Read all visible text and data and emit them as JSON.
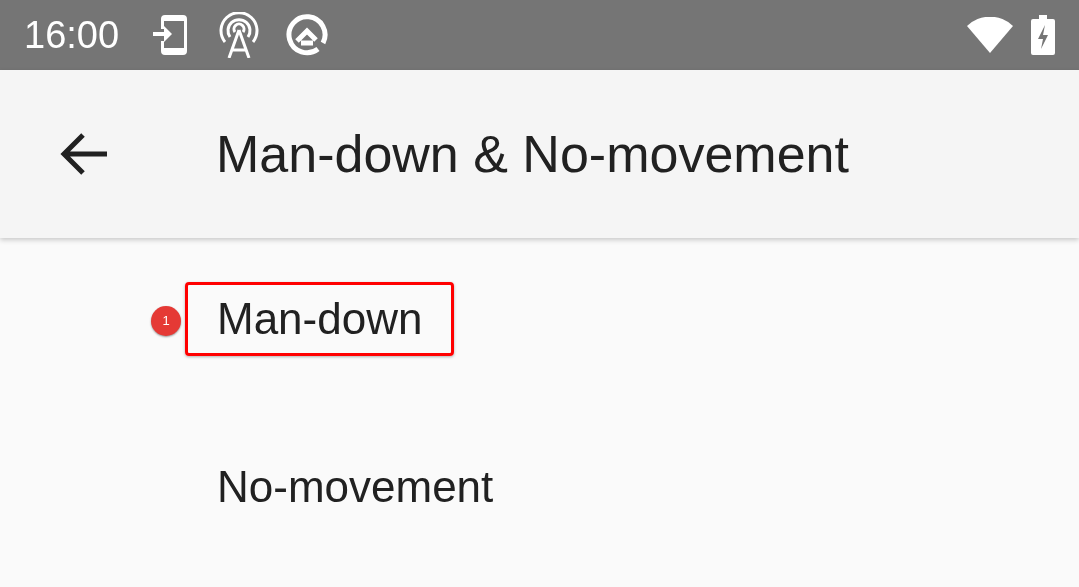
{
  "status_bar": {
    "time": "16:00"
  },
  "app_bar": {
    "title": "Man-down & No-movement"
  },
  "items": [
    {
      "label": "Man-down",
      "highlighted": true,
      "badge": "1"
    },
    {
      "label": "No-movement",
      "highlighted": false
    }
  ]
}
